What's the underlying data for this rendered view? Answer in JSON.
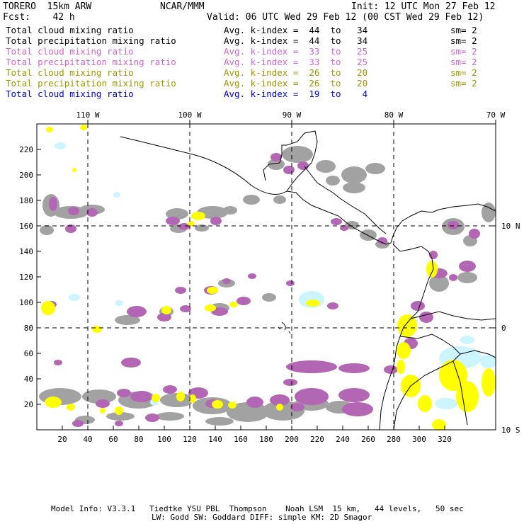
{
  "header": {
    "model": "TORERO  15km ARW",
    "org": "NCAR/MMM",
    "init": "Init: 12 UTC Mon 27 Feb 12",
    "fcst": "Fcst:    42 h",
    "valid": "Valid: 06 UTC Wed 29 Feb 12 (00 CST Wed 29 Feb 12)"
  },
  "fields": [
    {
      "name": "Total cloud mixing ratio",
      "kindex": "Avg. k-index =  44  to   34",
      "sm": "sm= 2",
      "color": "#000000"
    },
    {
      "name": "Total precipitation mixing ratio",
      "kindex": "Avg. k-index =  44  to   34",
      "sm": "sm= 2",
      "color": "#000000"
    },
    {
      "name": "Total cloud mixing ratio",
      "kindex": "Avg. k-index =  33  to   25",
      "sm": "sm= 2",
      "color": "#cc66cc"
    },
    {
      "name": "Total precipitation mixing ratio",
      "kindex": "Avg. k-index =  33  to   25",
      "sm": "sm= 2",
      "color": "#cc66cc"
    },
    {
      "name": "Total cloud mixing ratio",
      "kindex": "Avg. k-index =  26  to   20",
      "sm": "sm= 2",
      "color": "#999900"
    },
    {
      "name": "Total precipitation mixing ratio",
      "kindex": "Avg. k-index =  26  to   20",
      "sm": "sm= 2",
      "color": "#999900"
    },
    {
      "name": "Total cloud mixing ratio",
      "kindex": "Avg. k-index =  19  to    4",
      "sm": "",
      "color": "#0000cc"
    }
  ],
  "map": {
    "lon_labels": [
      "110 W",
      "100 W",
      "90 W",
      "80 W",
      "70 W"
    ],
    "lat_labels": [
      "10 N",
      "0",
      "10 S"
    ],
    "x_ticks": [
      "20",
      "40",
      "60",
      "80",
      "100",
      "120",
      "140",
      "160",
      "180",
      "200",
      "220",
      "240",
      "260",
      "280",
      "300",
      "320"
    ],
    "y_ticks": [
      "220",
      "200",
      "180",
      "160",
      "140",
      "120",
      "100",
      "80",
      "60",
      "40",
      "20"
    ],
    "colors": {
      "gray": "#999999",
      "purple": "#b366b3",
      "yellow": "#ffff00",
      "cyan": "#ccf5ff"
    }
  },
  "footer": {
    "line1": "Model Info: V3.3.1   Tiedtke YSU PBL  Thompson    Noah LSM  15 km,   44 levels,   50 sec",
    "line2": "LW: Godd SW: Goddard DIFF: simple KM: 2D Smagor"
  }
}
